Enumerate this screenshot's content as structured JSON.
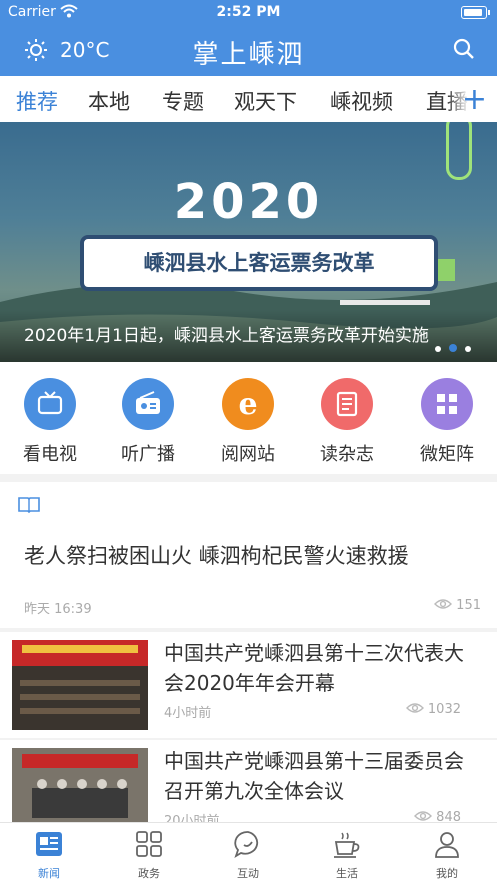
{
  "status_bar": {
    "carrier": "Carrier",
    "time": "2:52 PM"
  },
  "header": {
    "temperature": "20°C",
    "title": "掌上嵊泗"
  },
  "channel_tabs": [
    {
      "label": "推荐",
      "active": true
    },
    {
      "label": "本地",
      "active": false
    },
    {
      "label": "专题",
      "active": false
    },
    {
      "label": "观天下",
      "active": false
    },
    {
      "label": "嵊视频",
      "active": false
    },
    {
      "label": "直播",
      "active": false
    }
  ],
  "banner": {
    "year": "2020",
    "sign_text": "嵊泗县水上客运票务改革",
    "caption": "2020年1月1日起，嵊泗县水上客运票务改革开始实施",
    "active_slide_index": 1,
    "slide_count": 3
  },
  "shortcuts": [
    {
      "label": "看电视",
      "icon": "tv-icon",
      "color": "#4a8fe0"
    },
    {
      "label": "听广播",
      "icon": "radio-icon",
      "color": "#4a8fe0"
    },
    {
      "label": "阅网站",
      "icon": "browser-icon",
      "color": "#f08c1e"
    },
    {
      "label": "读杂志",
      "icon": "magazine-icon",
      "color": "#f06a6a"
    },
    {
      "label": "微矩阵",
      "icon": "grid-icon",
      "color": "#9a7fe0"
    }
  ],
  "feature_article": {
    "icon": "book-icon",
    "headline": "老人祭扫被困山火 嵊泗枸杞民警火速救援",
    "time": "昨天 16:39",
    "views": "151"
  },
  "news_list": [
    {
      "title": "中国共产党嵊泗县第十三次代表大会2020年年会开幕",
      "time": "4小时前",
      "views": "1032"
    },
    {
      "title": "中国共产党嵊泗县第十三届委员会召开第九次全体会议",
      "time": "20小时前",
      "views": "848"
    }
  ],
  "bottom_nav": [
    {
      "label": "新闻",
      "icon": "news-icon",
      "active": true
    },
    {
      "label": "政务",
      "icon": "apps-grid-icon",
      "active": false
    },
    {
      "label": "互动",
      "icon": "chat-icon",
      "active": false
    },
    {
      "label": "生活",
      "icon": "coffee-icon",
      "active": false
    },
    {
      "label": "我的",
      "icon": "user-icon",
      "active": false
    }
  ],
  "colors": {
    "brand": "#4a8fe0",
    "accent": "#3b82d6"
  }
}
